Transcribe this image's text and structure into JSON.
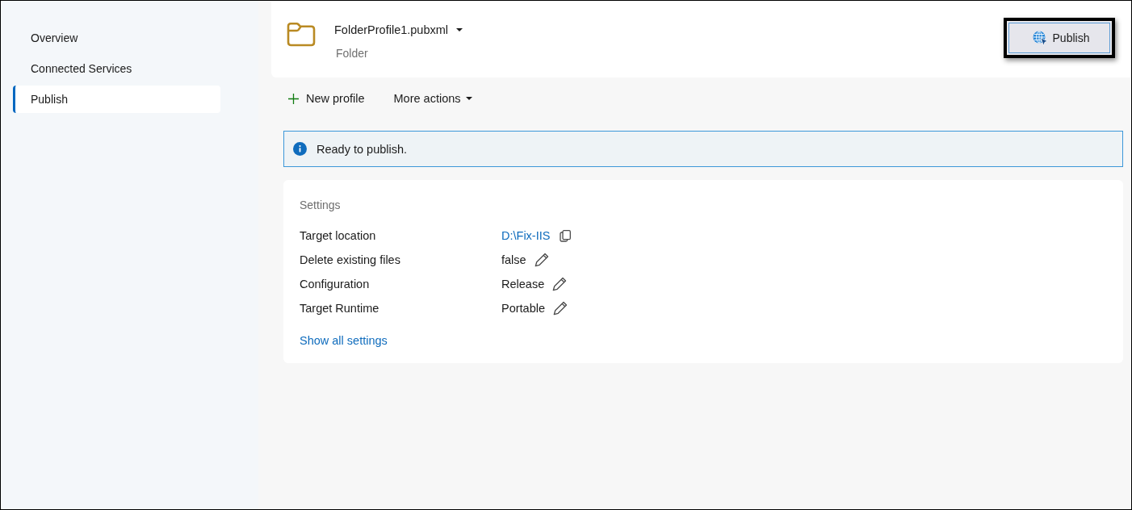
{
  "sidebar": {
    "items": [
      {
        "label": "Overview",
        "selected": false
      },
      {
        "label": "Connected Services",
        "selected": false
      },
      {
        "label": "Publish",
        "selected": true
      }
    ]
  },
  "profile": {
    "name": "FolderProfile1.pubxml",
    "type": "Folder"
  },
  "publish_button": {
    "label": "Publish",
    "highlighted": true
  },
  "toolbar": {
    "items": [
      {
        "label": "New profile",
        "kind": "add"
      },
      {
        "label": "More actions",
        "kind": "menu"
      }
    ]
  },
  "status": {
    "text": "Ready to publish."
  },
  "settings": {
    "title": "Settings",
    "rows": [
      {
        "label": "Target location",
        "value": "D:\\Fix-IIS",
        "kind": "link"
      },
      {
        "label": "Delete existing files",
        "value": "false",
        "kind": "editable"
      },
      {
        "label": "Configuration",
        "value": "Release",
        "kind": "editable"
      },
      {
        "label": "Target Runtime",
        "value": "Portable",
        "kind": "editable"
      }
    ],
    "show_all": "Show all settings"
  }
}
